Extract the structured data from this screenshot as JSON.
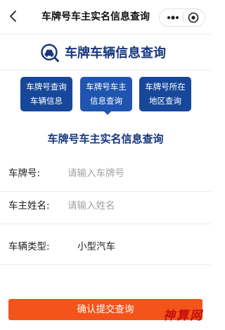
{
  "header": {
    "title": "车牌号车主实名信息查询",
    "back_icon": "chevron-left-icon",
    "more_icon": "more-dots-icon",
    "record_icon": "record-circle-icon"
  },
  "banner": {
    "icon": "car-search-icon",
    "title": "车牌车辆信息查询"
  },
  "quick_links": [
    {
      "line1": "车牌号查询",
      "line2": "车辆信息"
    },
    {
      "line1": "车牌号车主",
      "line2": "信息查询"
    },
    {
      "line1": "车牌号所在",
      "line2": "地区查询"
    }
  ],
  "form": {
    "title": "车牌号车主实名信息查询",
    "plate": {
      "label": "车牌号:",
      "placeholder": "请输入车牌号"
    },
    "owner": {
      "label": "车主姓名:",
      "placeholder": "请输入姓名"
    },
    "type": {
      "label": "车辆类型:",
      "value": "小型汽车"
    },
    "submit_label": "确认提交查询"
  },
  "watermark": "神算网",
  "colors": {
    "brand_blue": "#16367e",
    "button_blue": "#17479a",
    "submit_orange": "#f2541a",
    "watermark_red": "#c40e0e"
  }
}
